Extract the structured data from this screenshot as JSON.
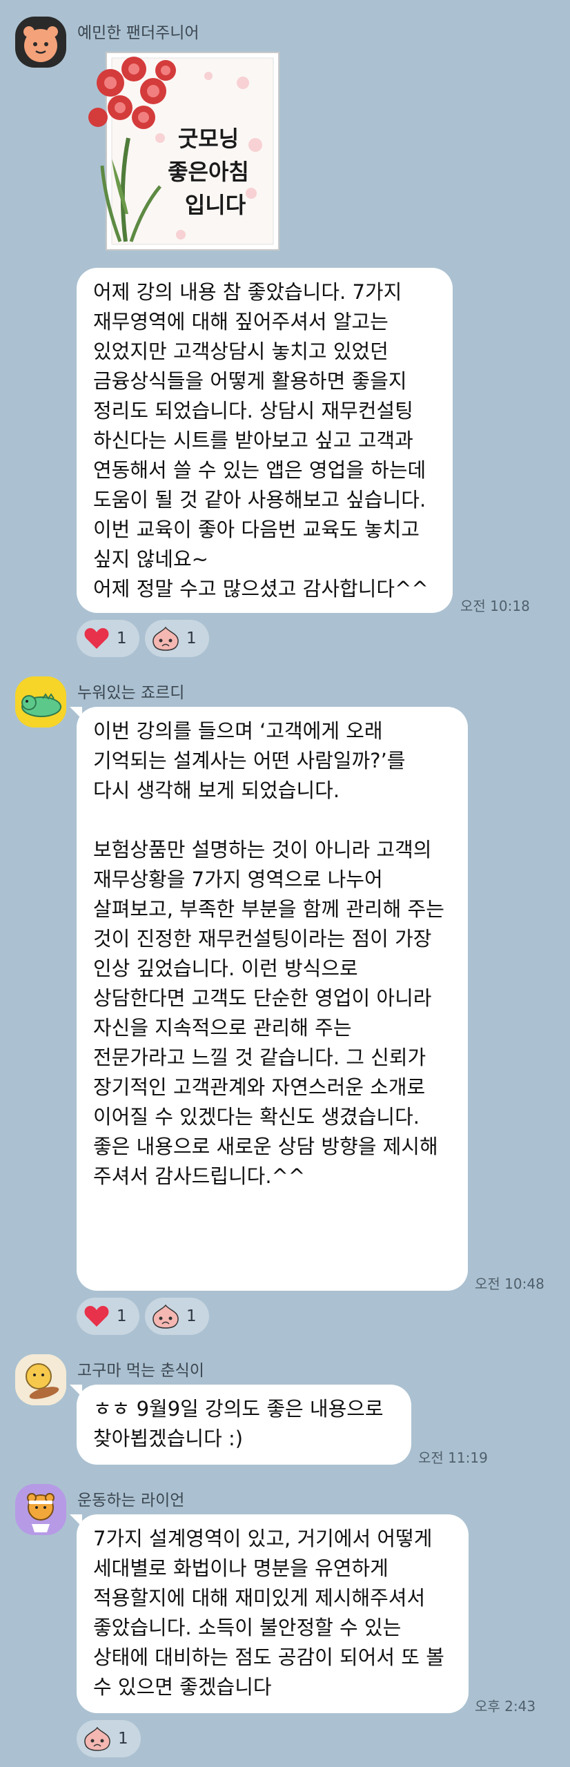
{
  "messages": [
    {
      "sender": "예민한 팬더주니어",
      "sticker_text": [
        "굿모닝",
        "좋은아침",
        "입니다"
      ],
      "text": "어제 강의 내용 참 좋았습니다. 7가지\n재무영역에 대해 짚어주셔서 알고는\n있었지만 고객상담시 놓치고 있었던\n금융상식들을 어떻게 활용하면 좋을지\n정리도 되었습니다. 상담시 재무컨설팅\n하신다는 시트를 받아보고 싶고 고객과\n연동해서 쓸 수 있는 앱은 영업을 하는데\n도움이 될 것 같아 사용해보고 싶습니다.\n이번 교육이 좋아 다음번 교육도 놓치고\n싶지 않네요~\n어제 정말 수고 많으셨고 감사합니다^^",
      "time": "오전 10:18",
      "reactions": [
        {
          "icon": "heart-icon",
          "count": "1"
        },
        {
          "icon": "apeach-icon",
          "count": "1"
        }
      ]
    },
    {
      "sender": "누워있는 죠르디",
      "text": "이번 강의를 들으며 ‘고객에게 오래\n기억되는 설계사는 어떤 사람일까?’를\n다시 생각해 보게 되었습니다.\n\n보험상품만 설명하는 것이 아니라 고객의\n재무상황을 7가지 영역으로 나누어\n살펴보고, 부족한 부분을 함께 관리해 주는\n것이 진정한 재무컨설팅이라는 점이 가장\n인상 깊었습니다. 이런 방식으로\n상담한다면 고객도 단순한 영업이 아니라\n자신을 지속적으로 관리해 주는\n전문가라고 느낄 것 같습니다. 그 신뢰가\n장기적인 고객관계와 자연스러운 소개로\n이어질 수 있겠다는 확신도 생겼습니다.\n좋은 내용으로 새로운 상담 방향을 제시해\n주셔서 감사드립니다.^^",
      "time": "오전 10:48",
      "reactions": [
        {
          "icon": "heart-icon",
          "count": "1"
        },
        {
          "icon": "apeach-icon",
          "count": "1"
        }
      ]
    },
    {
      "sender": "고구마 먹는 춘식이",
      "text": "ㅎㅎ 9월9일 강의도 좋은 내용으로\n찾아뵙겠습니다 :)",
      "time": "오전 11:19"
    },
    {
      "sender": "운동하는 라이언",
      "text": "7가지 설계영역이 있고, 거기에서 어떻게\n세대별로 화법이나 명분을 유연하게\n적용할지에 대해 재미있게 제시해주셔서\n좋았습니다. 소득이 불안정할 수 있는\n상태에 대비하는 점도 공감이 되어서 또 볼\n수 있으면 좋겠습니다",
      "time": "오후 2:43",
      "reactions": [
        {
          "icon": "apeach-icon",
          "count": "1"
        }
      ]
    }
  ]
}
